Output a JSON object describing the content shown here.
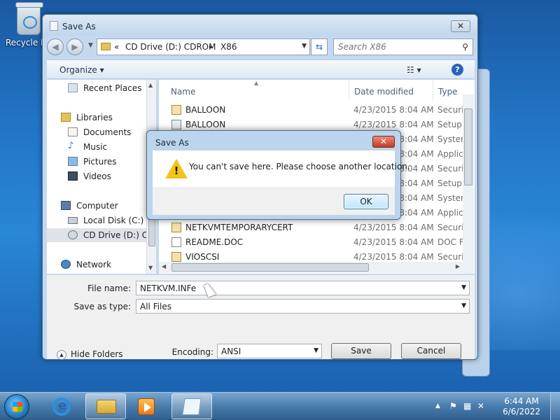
{
  "desktop": {
    "recycle_bin_label": "Recycle Bin"
  },
  "window": {
    "title": "Save As",
    "close_label": "✕",
    "back_icon": "back-arrow-icon",
    "forward_icon": "forward-arrow-icon",
    "address": {
      "prefix": "«",
      "crumb1": "CD Drive (D:) CDROM",
      "separator": "▸",
      "crumb2": "X86"
    },
    "search_placeholder": "Search X86",
    "organize_label": "Organize ▾",
    "view_label": "☷ ▾",
    "help_label": "?"
  },
  "nav_pane": {
    "items": [
      {
        "label": "Recent Places",
        "icon": "recent-places-icon"
      },
      {
        "label": "Libraries",
        "icon": "libraries-icon"
      },
      {
        "label": "Documents",
        "icon": "documents-icon"
      },
      {
        "label": "Music",
        "icon": "music-icon"
      },
      {
        "label": "Pictures",
        "icon": "pictures-icon"
      },
      {
        "label": "Videos",
        "icon": "videos-icon"
      },
      {
        "label": "Computer",
        "icon": "computer-icon"
      },
      {
        "label": "Local Disk (C:)",
        "icon": "local-disk-icon"
      },
      {
        "label": "CD Drive (D:) CDI",
        "icon": "cd-drive-icon"
      },
      {
        "label": "Network",
        "icon": "network-icon"
      }
    ]
  },
  "file_list": {
    "columns": [
      "Name",
      "Date modified",
      "Type"
    ],
    "rows": [
      {
        "name": "BALLOON",
        "date": "4/23/2015 8:04 AM",
        "type": "Securit"
      },
      {
        "name": "BALLOON",
        "date": "4/23/2015 8:04 AM",
        "type": "Setup I"
      },
      {
        "name": "",
        "date": "4/23/2015 8:04 AM",
        "type": "Systen"
      },
      {
        "name": "",
        "date": "4/23/2015 8:04 AM",
        "type": "Applic"
      },
      {
        "name": "",
        "date": "4/23/2015 8:04 AM",
        "type": "Securit"
      },
      {
        "name": "",
        "date": "4/23/2015 8:04 AM",
        "type": "Setup I"
      },
      {
        "name": "",
        "date": "4/23/2015 8:04 AM",
        "type": "Systen"
      },
      {
        "name": "",
        "date": "4/23/2015 8:04 AM",
        "type": "Applic"
      },
      {
        "name": "NETKVMTEMPORARYCERT",
        "date": "4/23/2015 8:04 AM",
        "type": "Securit"
      },
      {
        "name": "README.DOC",
        "date": "4/23/2015 8:04 AM",
        "type": "DOC F"
      },
      {
        "name": "VIOSCSI",
        "date": "4/23/2015 8:04 AM",
        "type": "Securit"
      }
    ]
  },
  "form": {
    "file_name_label": "File name:",
    "file_name_value": "NETKVM.INFe",
    "save_as_type_label": "Save as type:",
    "save_as_type_value": "All Files",
    "encoding_label": "Encoding:",
    "encoding_value": "ANSI",
    "save_label": "Save",
    "cancel_label": "Cancel",
    "hide_folders_label": "Hide Folders"
  },
  "alert": {
    "title": "Save As",
    "message": "You can't save here. Please choose another location.",
    "ok_label": "OK",
    "close_label": "✕",
    "icon": "warning-icon"
  },
  "taskbar": {
    "time": "6:44 AM",
    "date": "6/6/2022",
    "apps": [
      "internet-explorer-icon",
      "file-explorer-icon",
      "media-player-icon",
      "notepad-icon"
    ]
  }
}
